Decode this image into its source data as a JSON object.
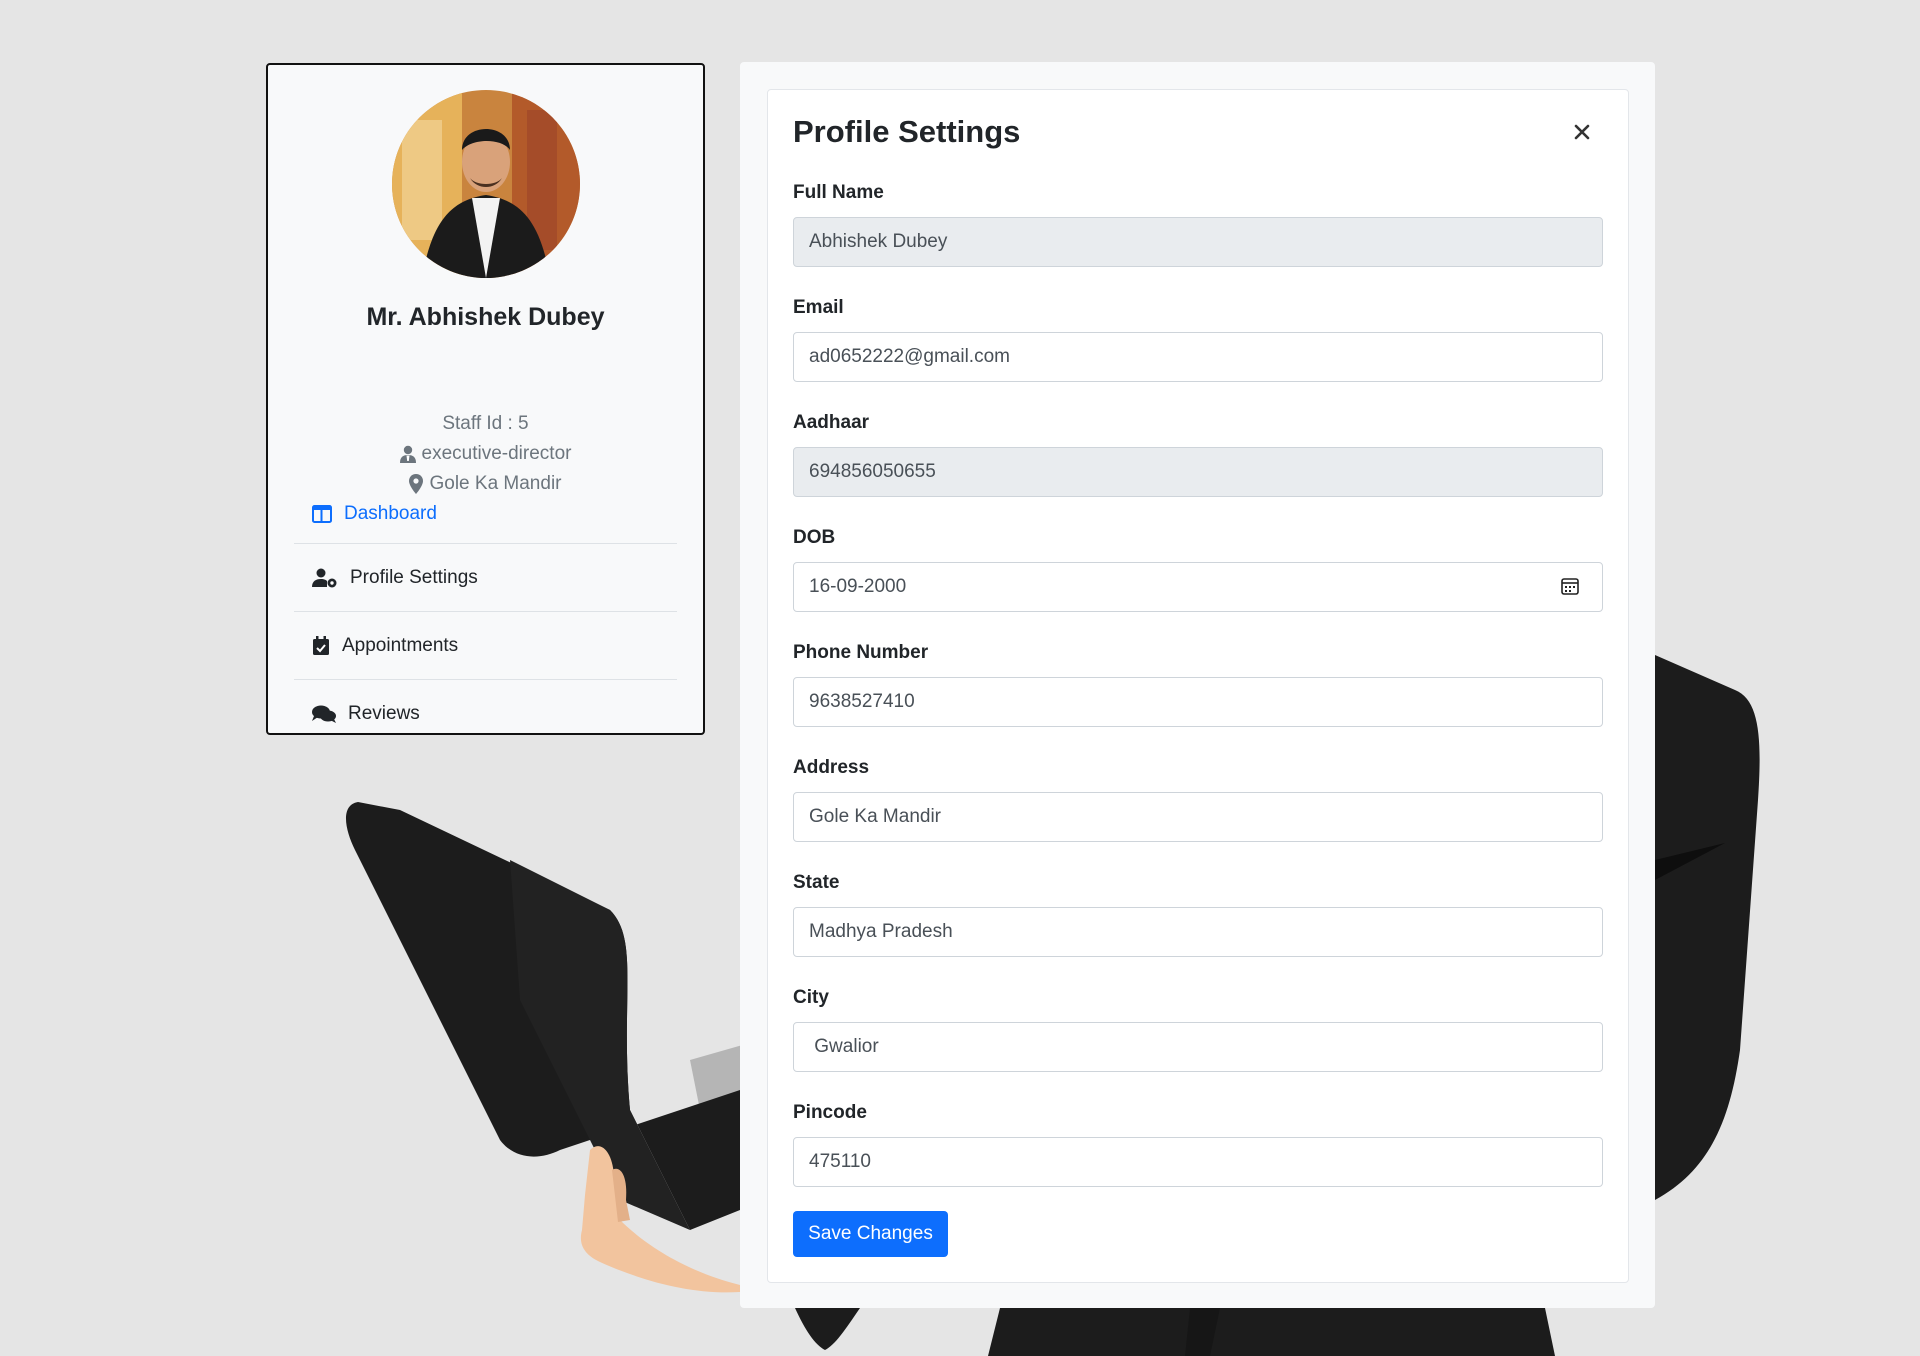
{
  "profile": {
    "name": "Mr. Abhishek Dubey",
    "staff_id": "Staff Id : 5",
    "role": "executive-director",
    "location": "Gole Ka Mandir"
  },
  "nav": {
    "items": [
      {
        "label": "Dashboard",
        "icon": "dashboard-icon",
        "active": true
      },
      {
        "label": "Profile Settings",
        "icon": "user-gear-icon",
        "active": false
      },
      {
        "label": "Appointments",
        "icon": "calendar-check-icon",
        "active": false
      },
      {
        "label": "Reviews",
        "icon": "comments-icon",
        "active": false
      }
    ]
  },
  "form": {
    "title": "Profile Settings",
    "fields": [
      {
        "label": "Full Name",
        "value": "Abhishek Dubey",
        "disabled": true
      },
      {
        "label": "Email",
        "value": "ad0652222@gmail.com",
        "disabled": false
      },
      {
        "label": "Aadhaar",
        "value": "694856050655",
        "disabled": true
      },
      {
        "label": "DOB",
        "value": "16-09-2000",
        "disabled": false,
        "icon": "calendar-icon"
      },
      {
        "label": "Phone Number",
        "value": "9638527410",
        "disabled": false
      },
      {
        "label": "Address",
        "value": "Gole Ka Mandir",
        "disabled": false
      },
      {
        "label": "State",
        "value": "Madhya Pradesh",
        "disabled": false
      },
      {
        "label": "City",
        "value": " Gwalior",
        "disabled": false
      },
      {
        "label": "Pincode",
        "value": "475110",
        "disabled": false
      }
    ],
    "save_label": "Save Changes"
  },
  "colors": {
    "accent": "#0d6efd",
    "page_bg": "#e5e5e5",
    "disabled_bg": "#e9ecef"
  }
}
